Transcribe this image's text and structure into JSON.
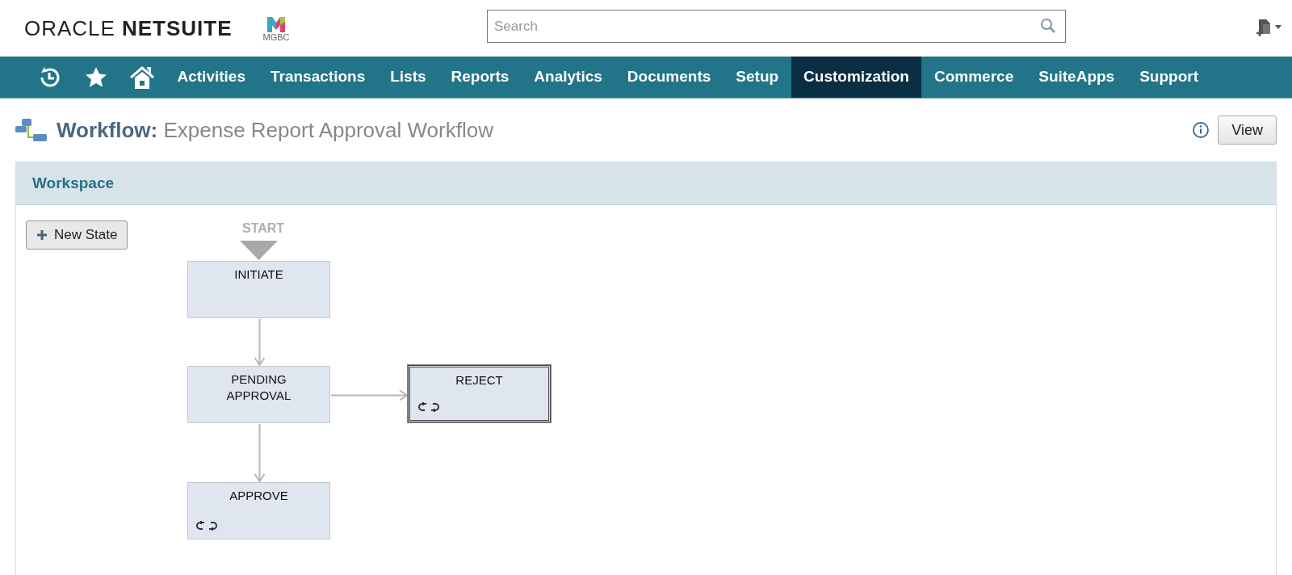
{
  "header": {
    "logo": {
      "word_1": "ORACLE",
      "word_2": "NETSUITE"
    },
    "company_logo": "MGBC",
    "search": {
      "placeholder": "Search"
    }
  },
  "nav": {
    "items": [
      {
        "label": "Activities",
        "selected": false
      },
      {
        "label": "Transactions",
        "selected": false
      },
      {
        "label": "Lists",
        "selected": false
      },
      {
        "label": "Reports",
        "selected": false
      },
      {
        "label": "Analytics",
        "selected": false
      },
      {
        "label": "Documents",
        "selected": false
      },
      {
        "label": "Setup",
        "selected": false
      },
      {
        "label": "Customization",
        "selected": true
      },
      {
        "label": "Commerce",
        "selected": false
      },
      {
        "label": "SuiteApps",
        "selected": false
      },
      {
        "label": "Support",
        "selected": false
      }
    ]
  },
  "page": {
    "record_type": "Workflow:",
    "title": "Expense Report Approval Workflow",
    "view_button": "View"
  },
  "workspace": {
    "title": "Workspace",
    "new_state_button": "New State",
    "start_label": "START",
    "states": [
      {
        "label": "INITIATE",
        "selected": false,
        "has_actions": false
      },
      {
        "label": "PENDING APPROVAL",
        "selected": false,
        "has_actions": false
      },
      {
        "label": "REJECT",
        "selected": true,
        "has_actions": true
      },
      {
        "label": "APPROVE",
        "selected": false,
        "has_actions": true
      }
    ]
  }
}
